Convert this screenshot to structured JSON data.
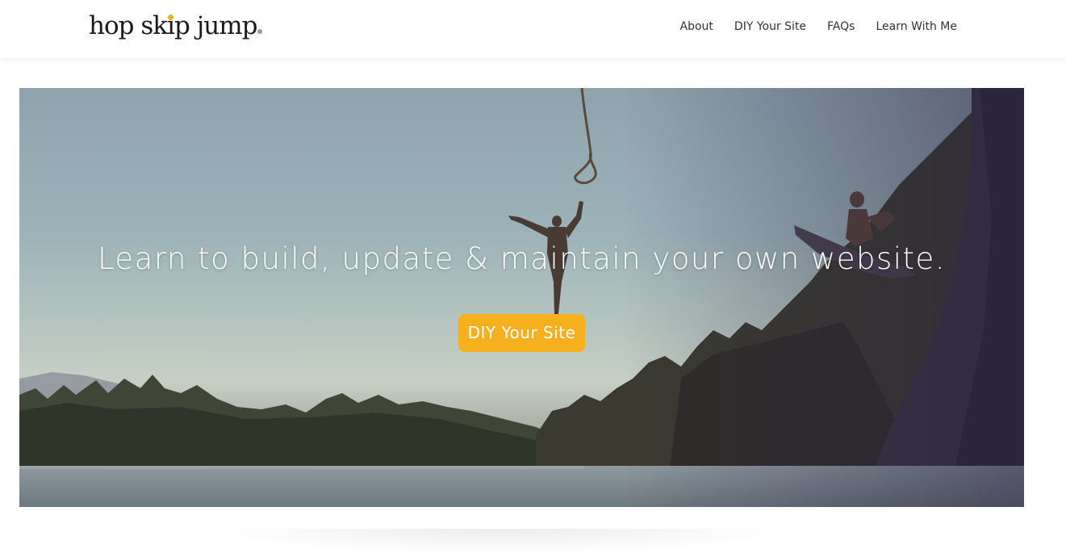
{
  "header": {
    "logo": {
      "text": "hop skip jump",
      "dot_color": "#f0b323",
      "end_dot_color": "#8aa0a8"
    },
    "nav": [
      {
        "label": "About"
      },
      {
        "label": "DIY Your Site"
      },
      {
        "label": "FAQs"
      },
      {
        "label": "Learn With Me"
      }
    ]
  },
  "hero": {
    "headline": "Learn to build, update & maintain your own website.",
    "cta_label": "DIY Your Site",
    "cta_color": "#f6b01e",
    "image_icon": "rope-swing-lake-photo"
  }
}
